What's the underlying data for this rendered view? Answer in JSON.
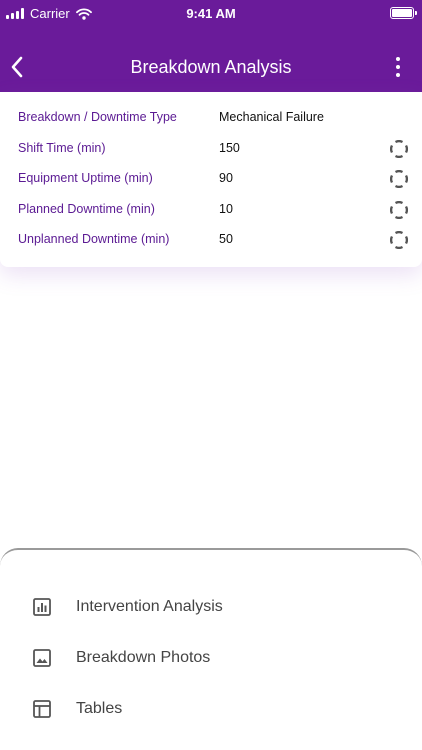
{
  "status_bar": {
    "carrier": "Carrier",
    "time": "9:41 AM"
  },
  "header": {
    "title": "Breakdown Analysis"
  },
  "fields": [
    {
      "label": "Breakdown / Downtime Type",
      "value": "Mechanical Failure",
      "has_spinner": false
    },
    {
      "label": "Shift Time (min)",
      "value": "150",
      "has_spinner": true
    },
    {
      "label": "Equipment Uptime (min)",
      "value": "90",
      "has_spinner": true
    },
    {
      "label": "Planned Downtime (min)",
      "value": "10",
      "has_spinner": true
    },
    {
      "label": "Unplanned Downtime (min)",
      "value": "50",
      "has_spinner": true
    }
  ],
  "sheet": {
    "items": [
      {
        "label": "Intervention Analysis",
        "icon": "bar-chart-icon"
      },
      {
        "label": "Breakdown Photos",
        "icon": "image-icon"
      },
      {
        "label": "Tables",
        "icon": "table-icon"
      }
    ]
  },
  "colors": {
    "header": "#6a1b9a",
    "label": "#5b1a93",
    "value": "#111111"
  }
}
